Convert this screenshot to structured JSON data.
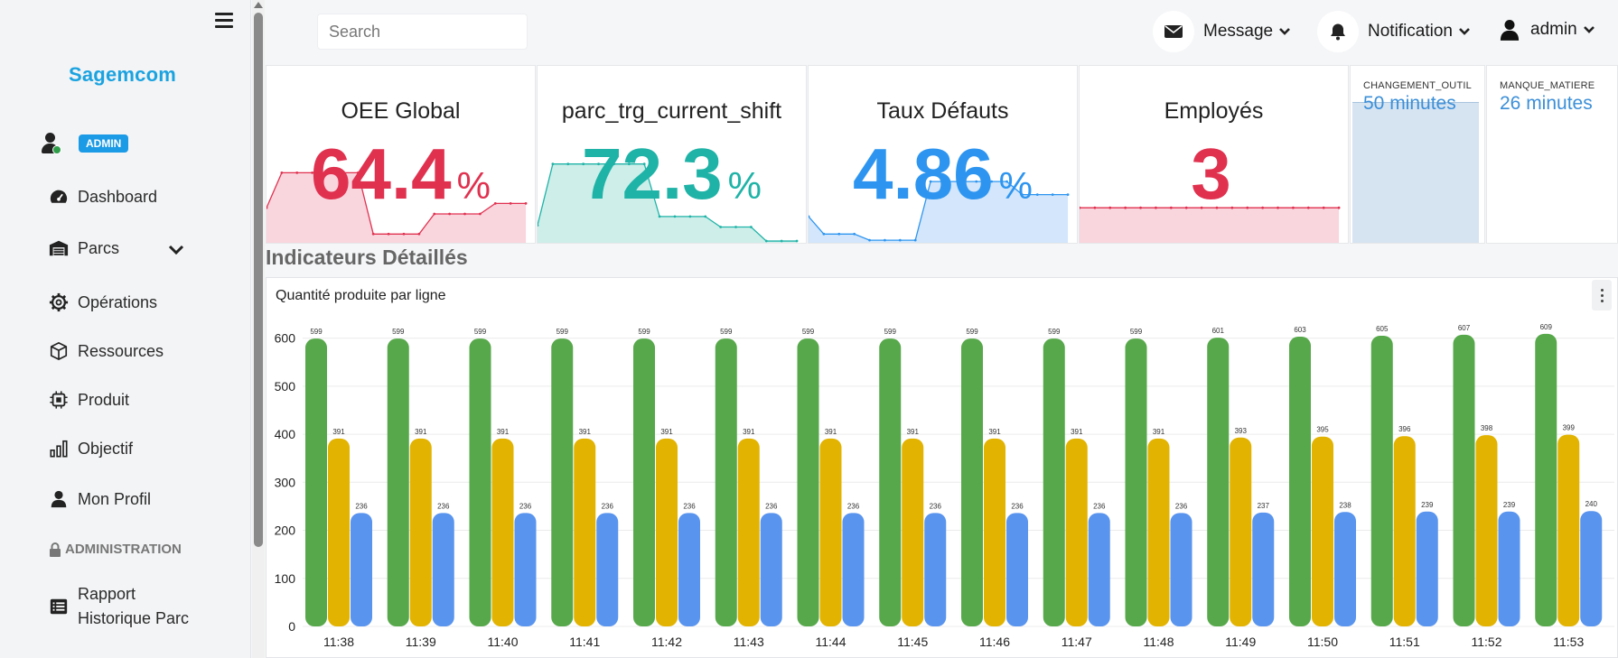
{
  "sidebar": {
    "logo": "Sagemcom",
    "user_badge": "ADMIN",
    "items": [
      {
        "label": "Dashboard",
        "icon": "gauge-icon"
      },
      {
        "label": "Parcs",
        "icon": "warehouse-icon"
      },
      {
        "label": "Opérations",
        "icon": "gear-icon"
      },
      {
        "label": "Ressources",
        "icon": "box-icon"
      },
      {
        "label": "Produit",
        "icon": "chip-icon"
      },
      {
        "label": "Objectif",
        "icon": "bar-chart-icon"
      },
      {
        "label": "Mon Profil",
        "icon": "user-icon"
      }
    ],
    "section_title": "ADMINISTRATION",
    "admin_items": [
      {
        "line1": "Rapport",
        "line2": "Historique Parc",
        "icon": "list-icon"
      }
    ]
  },
  "topbar": {
    "search_placeholder": "Search",
    "message_label": "Message",
    "notification_label": "Notification",
    "user_label": "admin"
  },
  "kpis": [
    {
      "title": "OEE Global",
      "value": "64.4",
      "unit": "%",
      "color": "#e0314f",
      "fill": "#f9d5dd",
      "trend": [
        40,
        80,
        80,
        80,
        80,
        80,
        80,
        10,
        10,
        10,
        10,
        33,
        33,
        33,
        33,
        45,
        45,
        45
      ]
    },
    {
      "title": "parc_trg_current_shift",
      "value": "72.3",
      "unit": "%",
      "color": "#1fb3a7",
      "fill": "#cdeee9",
      "trend": [
        20,
        90,
        90,
        90,
        90,
        90,
        90,
        90,
        30,
        30,
        30,
        30,
        18,
        18,
        18,
        2,
        2,
        2
      ]
    },
    {
      "title": "Taux Défauts",
      "value": "4.86",
      "unit": "%",
      "color": "#2d95f0",
      "fill": "#d3e6fb",
      "trend": [
        30,
        10,
        10,
        10,
        3,
        3,
        3,
        3,
        70,
        70,
        70,
        70,
        70,
        70,
        55,
        55,
        55,
        55
      ]
    },
    {
      "title": "Employés",
      "value": "3",
      "unit": "",
      "color": "#e0314f",
      "fill": "#f9d5dd",
      "trend": [
        40,
        40,
        40,
        40,
        40,
        40,
        40,
        40,
        40,
        40,
        40,
        40,
        40,
        40,
        40,
        40,
        40,
        40
      ]
    }
  ],
  "mini_cards": [
    {
      "label": "CHANGEMENT_OUTIL",
      "value": "50 minutes"
    },
    {
      "label": "MANQUE_MATIERE",
      "value": "26 minutes"
    }
  ],
  "section_header": "Indicateurs Détaillés",
  "chart_panel": {
    "title": "Quantité produite par ligne"
  },
  "chart_data": {
    "type": "bar",
    "categories": [
      "11:38",
      "11:39",
      "11:40",
      "11:41",
      "11:42",
      "11:43",
      "11:44",
      "11:45",
      "11:46",
      "11:47",
      "11:48",
      "11:49",
      "11:50",
      "11:51",
      "11:52",
      "11:53"
    ],
    "series": [
      {
        "color": "#57a84b",
        "values": [
          599,
          599,
          599,
          599,
          599,
          599,
          599,
          599,
          599,
          599,
          599,
          601,
          603,
          605,
          607,
          609
        ]
      },
      {
        "color": "#e2b300",
        "values": [
          391,
          391,
          391,
          391,
          391,
          391,
          391,
          391,
          391,
          391,
          391,
          393,
          395,
          396,
          398,
          399
        ]
      },
      {
        "color": "#5994ee",
        "values": [
          236,
          236,
          236,
          236,
          236,
          236,
          236,
          236,
          236,
          236,
          236,
          237,
          238,
          239,
          239,
          240
        ]
      }
    ],
    "yticks": [
      0,
      100,
      200,
      300,
      400,
      500,
      600
    ],
    "ylim": [
      0,
      650
    ],
    "grid": true
  }
}
